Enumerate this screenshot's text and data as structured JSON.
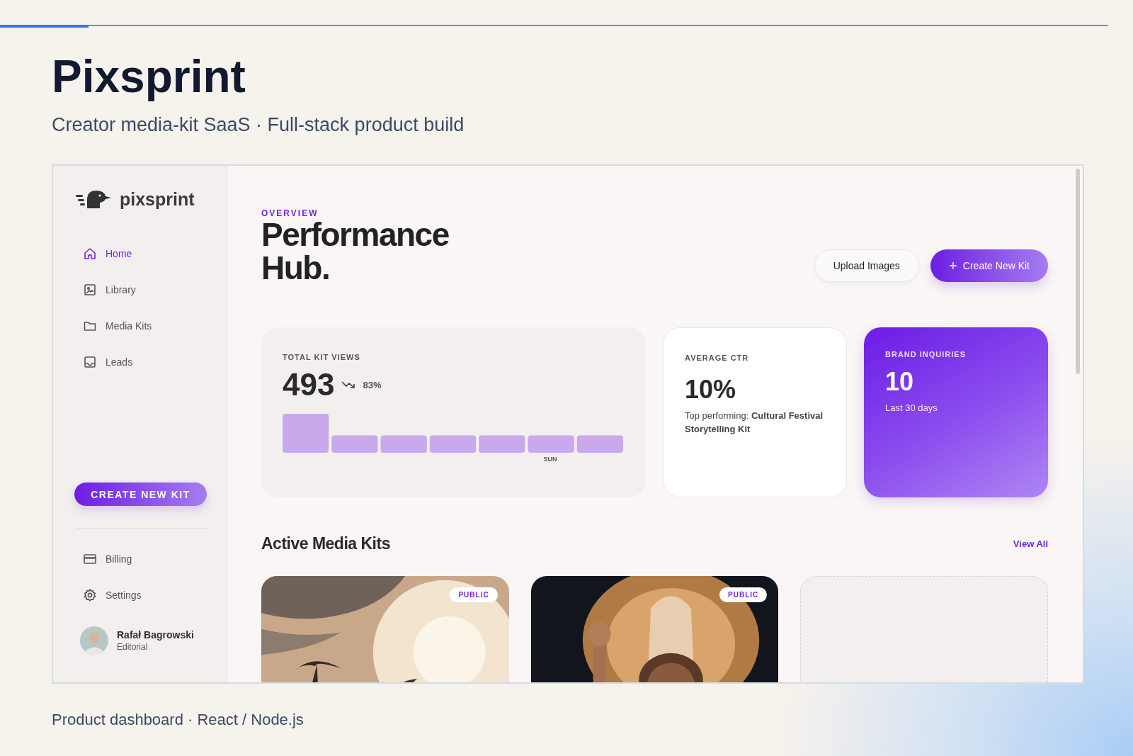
{
  "progress": {
    "level": 0.08
  },
  "header": {
    "title": "Pixsprint",
    "subtitle": "Creator media-kit SaaS · Full-stack product build"
  },
  "app": {
    "logo": "pixsprint",
    "nav": [
      {
        "label": "Home",
        "kind": "home",
        "selected": true
      },
      {
        "label": "Library",
        "kind": "library",
        "selected": false
      },
      {
        "label": "Media Kits",
        "kind": "kits",
        "selected": false
      },
      {
        "label": "Leads",
        "kind": "leads",
        "selected": false
      }
    ],
    "create_button": "CREATE NEW KIT",
    "bottom_nav": [
      {
        "label": "Billing",
        "kind": "billing",
        "selected": false
      },
      {
        "label": "Settings",
        "kind": "settings",
        "selected": false
      }
    ],
    "user": {
      "name": "Rafał Bagrowski",
      "role": "Editorial"
    },
    "overview_label": "OVERVIEW",
    "title": "Performance Hub.",
    "actions": [
      {
        "label": "Upload Images",
        "kind": "secondary"
      },
      {
        "label": "Create New Kit",
        "kind": "primary"
      }
    ],
    "stats": [
      {
        "kind": "views",
        "label": "TOTAL KIT VIEWS",
        "value": "493",
        "change": "83%",
        "chart_label": "SUN"
      },
      {
        "kind": "ctr",
        "label": "AVERAGE CTR",
        "value": "10%",
        "note": "Top performing: **Cultural Festival Storytelling Kit**"
      },
      {
        "kind": "brand",
        "label": "BRAND INQUIRIES",
        "value": "10",
        "note": "Last 30 days"
      }
    ],
    "section": {
      "title": "Active Media Kits",
      "link": "View All"
    },
    "kits": [
      {
        "kind": "sunset",
        "badge": "PUBLIC"
      },
      {
        "kind": "dancer",
        "badge": "PUBLIC"
      },
      {
        "kind": "empty"
      }
    ]
  },
  "caption": "Product dashboard · React / Node.js"
}
